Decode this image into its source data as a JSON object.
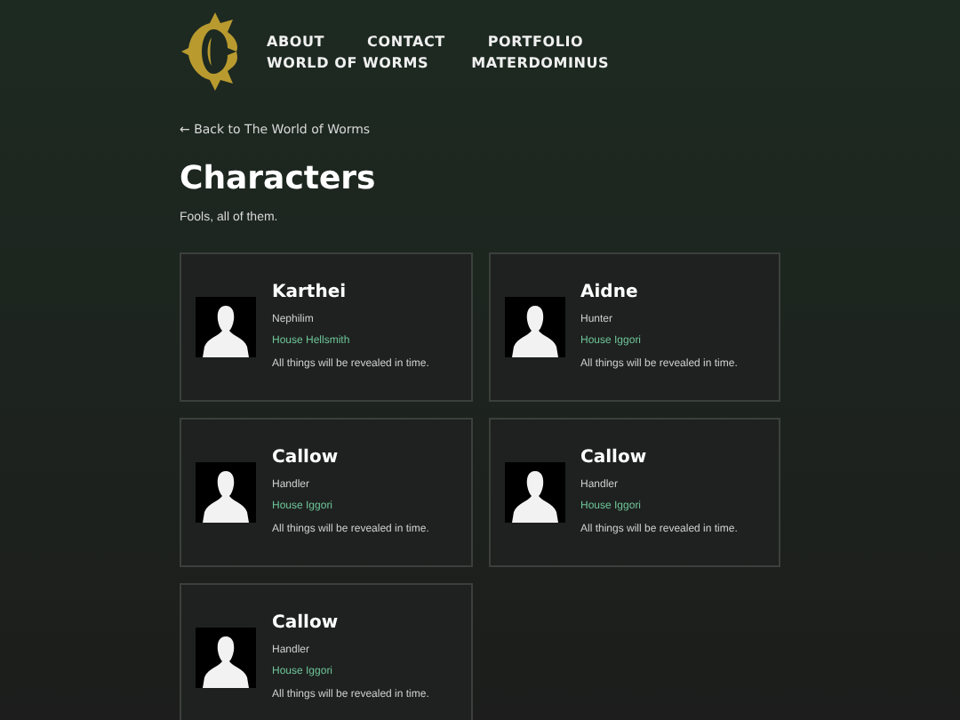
{
  "nav": {
    "items": [
      "ABOUT",
      "CONTACT",
      "PORTFOLIO",
      "WORLD OF WORMS",
      "MATERDOMINUS"
    ]
  },
  "back_link": "← Back to The World of Worms",
  "title": "Characters",
  "subtitle": "Fools, all of them.",
  "characters": [
    {
      "name": "Karthei",
      "role": "Nephilim",
      "house": "House Hellsmith",
      "description": "All things will be revealed in time."
    },
    {
      "name": "Aidne",
      "role": "Hunter",
      "house": "House Iggori",
      "description": "All things will be revealed in time."
    },
    {
      "name": "Callow",
      "role": "Handler",
      "house": "House Iggori",
      "description": "All things will be revealed in time."
    },
    {
      "name": "Callow",
      "role": "Handler",
      "house": "House Iggori",
      "description": "All things will be revealed in time."
    },
    {
      "name": "Callow",
      "role": "Handler",
      "house": "House Iggori",
      "description": "All things will be revealed in time."
    }
  ]
}
